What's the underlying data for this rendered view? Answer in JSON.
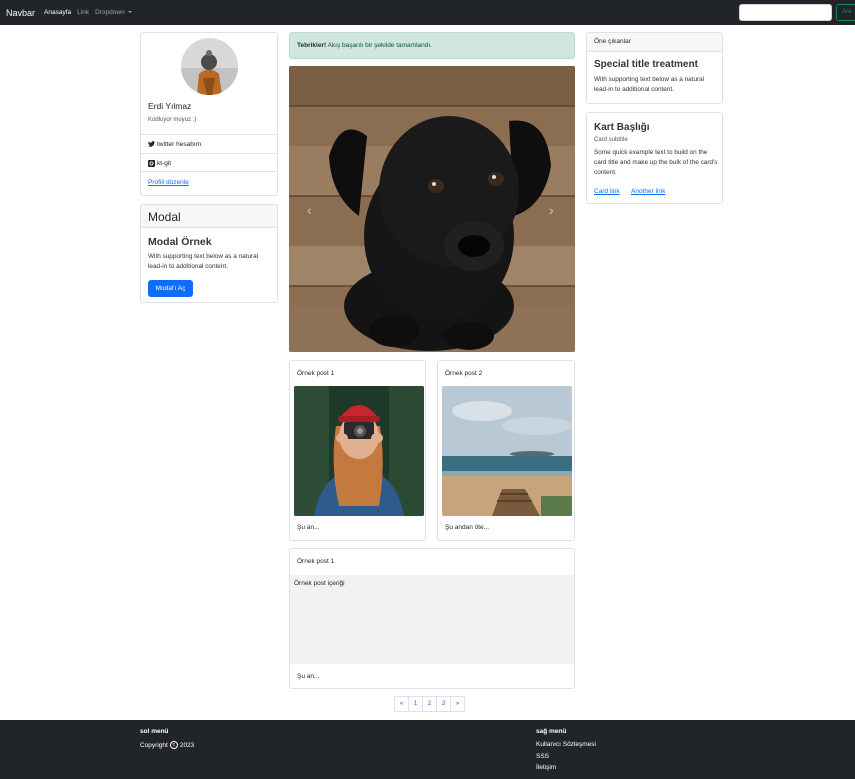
{
  "navbar": {
    "brand": "Navbar",
    "links": [
      "Anasayfa",
      "Link",
      "Dropdown"
    ],
    "search_placeholder": "",
    "search_button": "Ara"
  },
  "profile": {
    "name": "Erdi Yılmaz",
    "subtitle": "Kodluyor muyuz :)",
    "items": [
      {
        "icon": "twitter-icon",
        "label": "twitter hesabım"
      },
      {
        "icon": "github-icon",
        "label": "kt-git"
      }
    ],
    "edit_link": "Profili düzenle"
  },
  "modal_card": {
    "header": "Modal",
    "title": "Modal Örnek",
    "text": "With supporting text below as a natural lead-in to additional content.",
    "button": "Modal'ı Aç"
  },
  "alert": {
    "bold": "Tebrikler!",
    "text": " Akış başarılı bir şekilde tamamlandı."
  },
  "carousel": {
    "prev": "‹",
    "next": "›"
  },
  "posts": [
    {
      "header": "Örnek post 1",
      "footer": "Şu an..."
    },
    {
      "header": "Örnek post 2",
      "footer": "Şu andan öte..."
    }
  ],
  "wide_post": {
    "header": "Örnek post 1",
    "body": "Örnek post içeriği",
    "footer": "Şu an..."
  },
  "pagination": [
    "«",
    "1",
    "2",
    "3",
    "»"
  ],
  "featured": {
    "header": "Öne çıkanlar",
    "title": "Special title treatment",
    "text": "With supporting text below as a natural lead-in to additional content."
  },
  "kart": {
    "title": "Kart Başlığı",
    "subtitle": "Card subtitle",
    "text": "Some quick example text to build on the card title and make up the bulk of the card's content.",
    "link1": "Card link",
    "link2": "Another link"
  },
  "footer": {
    "left_heading": "sol menü",
    "copyright": "Copyright",
    "year": "2023",
    "right_heading": "sağ menü",
    "right_links": [
      "Kullanıcı Sözleşmesi",
      "SSS",
      "İletişim"
    ]
  },
  "colors": {
    "navbar_bg": "#212529",
    "primary": "#0d6efd",
    "success": "#198754",
    "alert_bg": "#d1e7dd"
  }
}
